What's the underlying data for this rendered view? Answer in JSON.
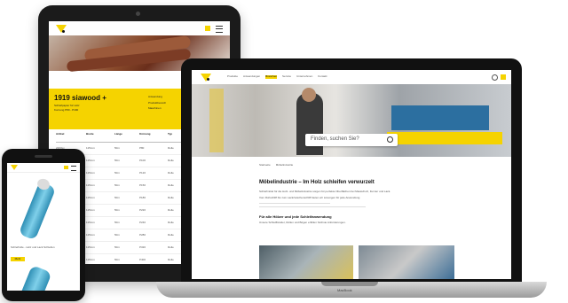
{
  "colors": {
    "brand_yellow": "#f5d300",
    "device_black": "#111111",
    "photo_wood": "#8a4b2c",
    "photo_blue": "#2c6fa0",
    "photo_grey": "#c9c9c9"
  },
  "tablet": {
    "hero_title": "1919 siawood +",
    "hero_sub1": "Schleifpapier für Holz",
    "hero_sub2": "Kornung P80 - P400",
    "info_lines": [
      "Anwendung",
      "Produktbereich",
      "Maschinen"
    ],
    "table_headers": [
      "Artikel",
      "Breite",
      "Länge",
      "Körnung",
      "Typ",
      "Preis"
    ],
    "table_rows": [
      [
        "2203xx",
        "115mm",
        "50m",
        "P80",
        "Rolle",
        "ab"
      ],
      [
        "2203xx",
        "115mm",
        "50m",
        "P100",
        "Rolle",
        "ab"
      ],
      [
        "2203xx",
        "115mm",
        "50m",
        "P120",
        "Rolle",
        "ab"
      ],
      [
        "2203xx",
        "115mm",
        "50m",
        "P150",
        "Rolle",
        "ab"
      ],
      [
        "2203xx",
        "115mm",
        "50m",
        "P180",
        "Rolle",
        "ab"
      ],
      [
        "2203xx",
        "115mm",
        "50m",
        "P220",
        "Rolle",
        "ab"
      ],
      [
        "2203xx",
        "115mm",
        "50m",
        "P240",
        "Rolle",
        "ab"
      ],
      [
        "2203xx",
        "115mm",
        "50m",
        "P280",
        "Rolle",
        "ab"
      ],
      [
        "2203xx",
        "115mm",
        "50m",
        "P320",
        "Rolle",
        "ab"
      ],
      [
        "2203xx",
        "115mm",
        "50m",
        "P400",
        "Rolle",
        "ab"
      ]
    ]
  },
  "laptop": {
    "nav_items": [
      "Produkte",
      "Anwendungen",
      "Branchen",
      "Service",
      "Unternehmen",
      "Kontakt"
    ],
    "search_placeholder": "Finden, suchen Sie?",
    "breadcrumb": [
      "Startseite",
      "Möbelindustrie"
    ],
    "headline": "Möbelindustrie – Im Holz schleifen verwurzelt",
    "para1": "Schleifmittel für die Holz- und Möbelindustrie sorgen für perfekte Oberflächen bei Massivholz, Furnier und Lack.",
    "para2": "Vom Rohschliff bis zum Lackzwischenschliff bieten wir Lösungen für jede Anwendung.",
    "subheading": "Für alle Hölzer und jede Schleifanwendung",
    "para3": "Unsere Schleifbänder, Rollen und Bögen erfüllen höchste Anforderungen.",
    "base_brand": "MacBook"
  },
  "phone": {
    "caption": "Schleifrolle - Holz und Lack Schleifen",
    "button_label": "Mehr"
  }
}
